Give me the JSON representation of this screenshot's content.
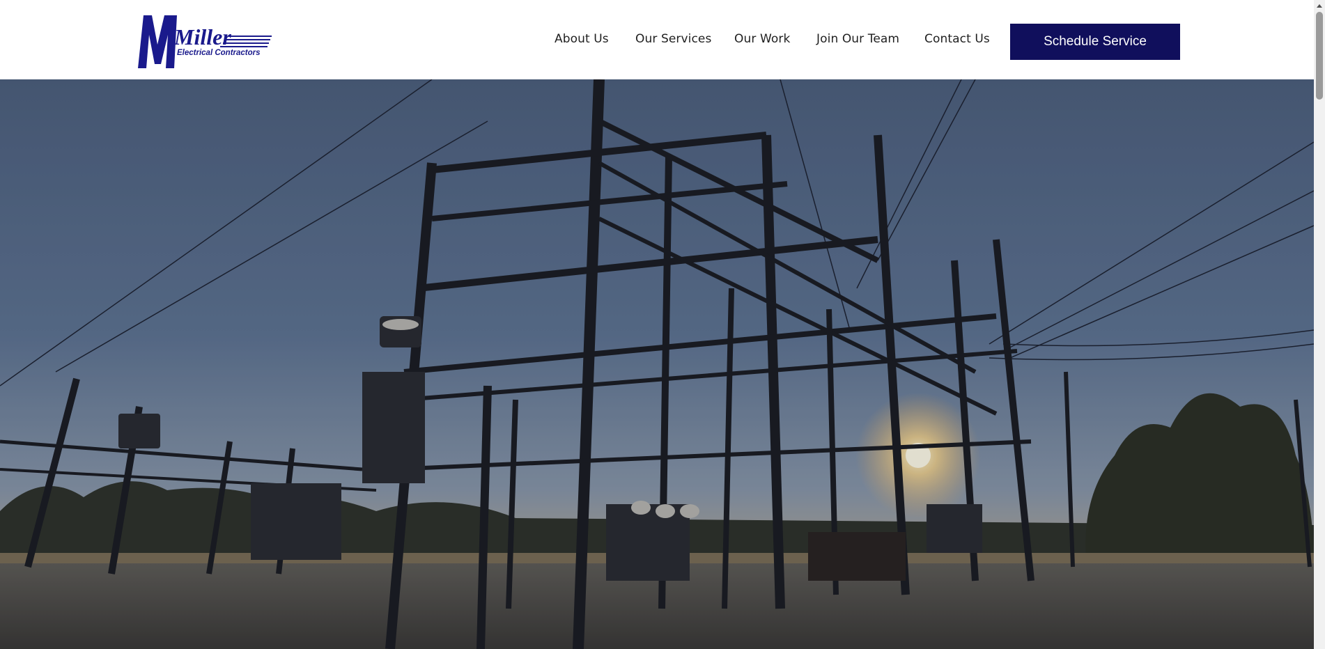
{
  "brand": {
    "logo_main": "Miller",
    "logo_sub": "Electrical Contractors",
    "color": "#1a1a8c"
  },
  "nav": {
    "items": [
      {
        "label": "About Us"
      },
      {
        "label": "Our Services"
      },
      {
        "label": "Our Work"
      },
      {
        "label": "Join Our Team"
      },
      {
        "label": "Contact Us"
      }
    ],
    "cta_label": "Schedule Service",
    "cta_color": "#100f5c"
  },
  "hero": {
    "image_subject": "electrical substation at sunset"
  },
  "icons": {
    "scroll_up": "chevron-up-icon"
  }
}
